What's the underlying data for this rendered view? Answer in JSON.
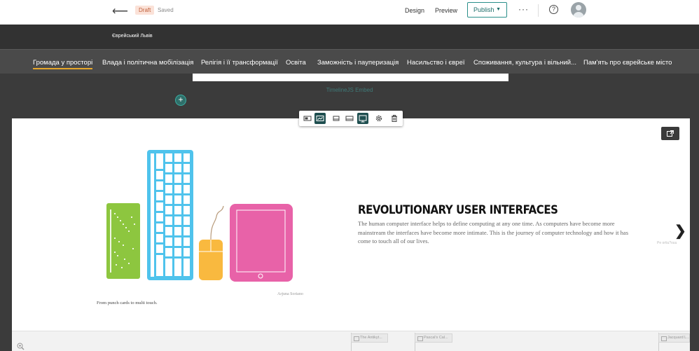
{
  "topbar": {
    "back_icon": "arrow-left-icon",
    "status_badge": "Draft",
    "save_status": "Saved",
    "design_label": "Design",
    "preview_label": "Preview",
    "publish_label": "Publish",
    "more_icon": "ellipsis-icon",
    "help_icon": "help-circle-icon",
    "avatar_icon": "user-avatar-icon"
  },
  "site": {
    "title": "Єврейський Львів"
  },
  "nav": {
    "items": [
      {
        "label": "Громада у просторі",
        "active": true
      },
      {
        "label": "Влада і політична мобілізація"
      },
      {
        "label": "Релігія і її трансформації"
      },
      {
        "label": "Освіта"
      },
      {
        "label": "Заможність і пауперизація"
      },
      {
        "label": "Насильство і євреї"
      },
      {
        "label": "Споживання, культура і вільний..."
      },
      {
        "label": "Пам'ять про єврейське місто"
      }
    ]
  },
  "embed": {
    "caption": "TimelineJS Embed",
    "add_icon": "plus-circle-icon"
  },
  "toolbar": {
    "buttons": [
      {
        "icon": "align-left-icon"
      },
      {
        "icon": "align-wide-icon",
        "selected": true
      },
      {
        "icon": "size-small-icon"
      },
      {
        "icon": "size-medium-icon"
      },
      {
        "icon": "size-fullwidth-icon",
        "selected": true
      },
      {
        "icon": "gear-icon"
      },
      {
        "icon": "trash-icon"
      }
    ]
  },
  "slide": {
    "title": "REVOLUTIONARY USER INTERFACES",
    "text": "The human computer interface helps to define computing at any one time. As computers have become more mainstream the interfaces have become more intimate. This is the journey of computer technology and how it has come to touch all of our lives.",
    "next_label": "Pe ortiu?ouu",
    "media_credit": "Arjuna Soriano",
    "media_caption": "From punch cards to multi touch.",
    "colors": {
      "punch_card": "#8dc63f",
      "keyboard": "#4fc3ec",
      "mouse": "#f9b93f",
      "tablet": "#e862a8"
    }
  },
  "timenav": {
    "zoom_icon": "zoom-in-icon",
    "markers": [
      {
        "label": "The Antikyt..."
      },
      {
        "label": "Pascal's Cal..."
      },
      {
        "label": "Jacquard L..."
      }
    ]
  }
}
